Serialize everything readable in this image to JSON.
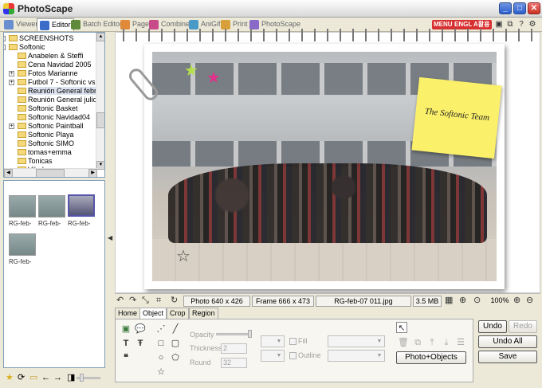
{
  "window": {
    "title": "PhotoScape",
    "minimize_glyph": "_",
    "maximize_glyph": "□",
    "close_glyph": "✕"
  },
  "tabs": [
    {
      "label": "Viewer",
      "icon": "viewer-icon",
      "color": "#6a8fcf"
    },
    {
      "label": "Editor",
      "icon": "editor-icon",
      "color": "#3a6cc8"
    },
    {
      "label": "Batch Editor",
      "icon": "batch-editor-icon",
      "color": "#5f8a3a"
    },
    {
      "label": "Page",
      "icon": "page-icon",
      "color": "#e08a3a"
    },
    {
      "label": "Combine",
      "icon": "combine-icon",
      "color": "#c84a8a"
    },
    {
      "label": "AniGif",
      "icon": "anigif-icon",
      "color": "#4a9ac8"
    },
    {
      "label": "Print",
      "icon": "print-icon",
      "color": "#d8a03a"
    },
    {
      "label": "PhotoScape",
      "icon": "photoscape-icon",
      "color": "#8a6ac8"
    }
  ],
  "right_toolbar": {
    "badges": [
      {
        "label": "MENU",
        "color": "#d83030"
      },
      {
        "label": "ENGL",
        "color": "#d83030"
      },
      {
        "label": "A활용",
        "color": "#d83030"
      }
    ],
    "icons": [
      {
        "name": "folder-icon",
        "glyph": "▣"
      },
      {
        "name": "window-icon",
        "glyph": "⧉"
      },
      {
        "name": "help-icon",
        "glyph": "?"
      },
      {
        "name": "settings-icon",
        "glyph": "⚙"
      }
    ]
  },
  "tree": {
    "items": [
      {
        "label": "SCREENSHOTS",
        "expander": "+"
      },
      {
        "label": "Softonic",
        "expander": "-"
      },
      {
        "label": "Anabelen & Steffi",
        "expander": ""
      },
      {
        "label": "Cena Navidad 2005",
        "expander": ""
      },
      {
        "label": "Fotos Marianne",
        "expander": "+"
      },
      {
        "label": "Futbol 7 - Softonic vs",
        "expander": "+"
      },
      {
        "label": "Reunión General febr",
        "expander": ""
      },
      {
        "label": "Reunión General julio",
        "expander": ""
      },
      {
        "label": "Softonic Basket",
        "expander": ""
      },
      {
        "label": "Softonic Navidad04",
        "expander": ""
      },
      {
        "label": "Softonic Paintball",
        "expander": "+"
      },
      {
        "label": "Softonic Playa",
        "expander": ""
      },
      {
        "label": "Softonic SIMO",
        "expander": ""
      },
      {
        "label": "tomas+emma",
        "expander": ""
      },
      {
        "label": "Tonicas",
        "expander": ""
      },
      {
        "label": "Viladrau",
        "expander": ""
      }
    ],
    "selected_index": 6
  },
  "thumbnails": [
    {
      "label": "RG-feb-",
      "selected": false
    },
    {
      "label": "RG-feb-",
      "selected": false
    },
    {
      "label": "RG-feb-",
      "selected": true
    },
    {
      "label": "RG-feb-",
      "selected": false
    }
  ],
  "canvas": {
    "note_text": "The Softonic Team"
  },
  "status": {
    "photo_size": "Photo 640 x 426",
    "frame_size": "Frame 666 x 473",
    "filename": "RG-feb-07 011.jpg",
    "file_size": "3.5 MB",
    "zoom": "100%"
  },
  "editor": {
    "tabs": [
      "Home",
      "Object",
      "Crop",
      "Region"
    ],
    "active_tab": "Object",
    "opacity_label": "Opacity",
    "thickness_label": "Thickness",
    "thickness_value": "2",
    "round_label": "Round",
    "round_value": "32",
    "fill_label": "Fill",
    "outline_label": "Outline",
    "photo_objects_label": "Photo+Objects"
  },
  "actions": {
    "undo": "Undo",
    "redo": "Redo",
    "undo_all": "Undo All",
    "save": "Save"
  }
}
